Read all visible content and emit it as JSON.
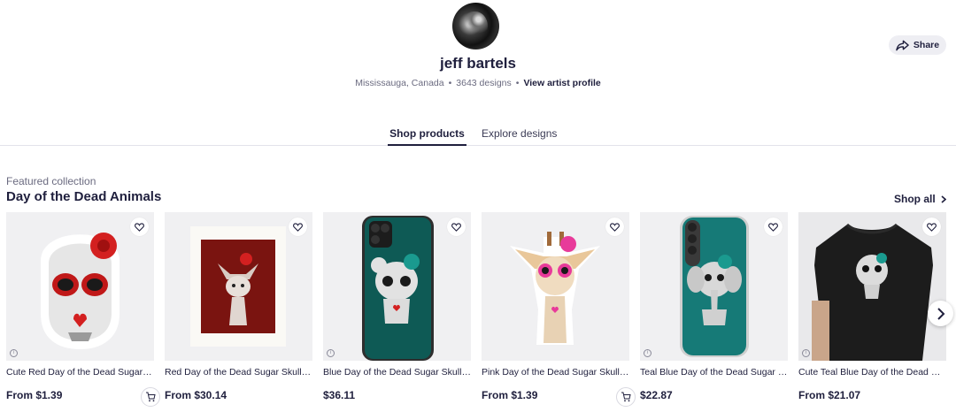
{
  "artist": {
    "name": "jeff bartels",
    "location": "Mississauga, Canada",
    "designs": "3643 designs",
    "view_profile": "View artist profile",
    "separator": "•"
  },
  "header": {
    "share_label": "Share"
  },
  "tabs": [
    {
      "label": "Shop products",
      "active": true
    },
    {
      "label": "Explore designs",
      "active": false
    }
  ],
  "collection": {
    "kicker": "Featured collection",
    "title": "Day of the Dead Animals",
    "shop_all": "Shop all"
  },
  "products": [
    {
      "title": "Cute Red Day of the Dead Sugar Skull Owl",
      "price": "From $1.39",
      "image": "sticker-owl",
      "cart": true
    },
    {
      "title": "Red Day of the Dead Sugar Skull Chihuahua",
      "price": "From $30.14",
      "image": "art-print-chihuahua",
      "cart": false
    },
    {
      "title": "Blue Day of the Dead Sugar Skull Bear",
      "price": "$36.11",
      "image": "phone-case-bear",
      "cart": false
    },
    {
      "title": "Pink Day of the Dead Sugar Skull Giraffe",
      "price": "From $1.39",
      "image": "sticker-giraffe",
      "cart": true
    },
    {
      "title": "Teal Blue Day of the Dead Sugar Skull Elephant",
      "price": "$22.87",
      "image": "phone-case-elephant",
      "cart": false
    },
    {
      "title": "Cute Teal Blue Day of the Dead Sugar Skull Bear",
      "price": "From $21.07",
      "image": "tshirt-bear",
      "cart": false
    }
  ],
  "colors": {
    "text": "#1f1f3d",
    "muted": "#6b6b80",
    "teal": "#0e5a55",
    "red": "#d32020",
    "share_bg": "#eeeef3"
  }
}
